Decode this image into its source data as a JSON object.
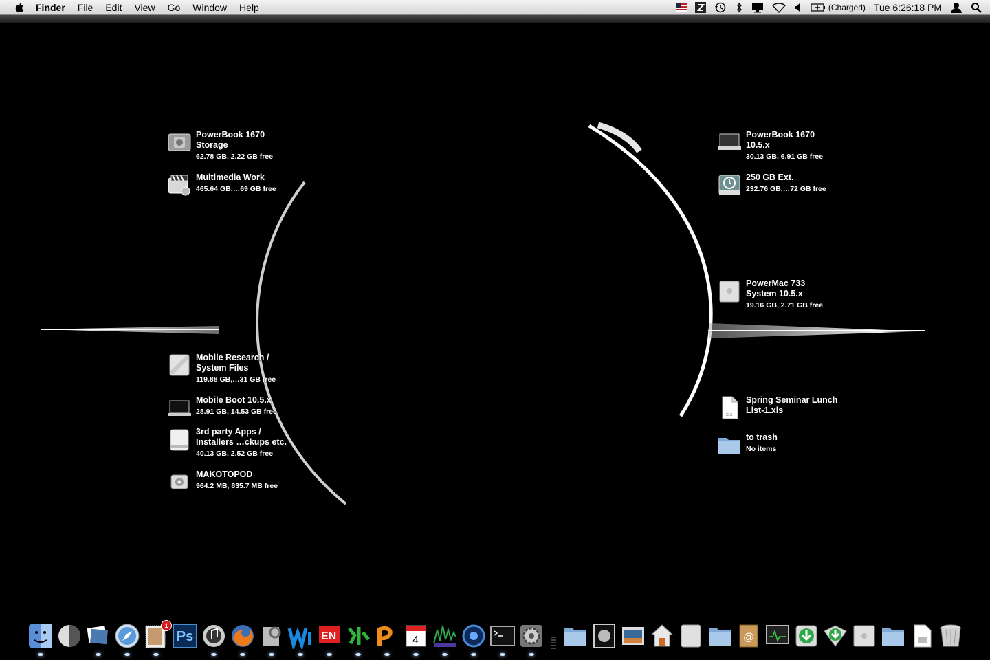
{
  "menubar": {
    "app_name": "Finder",
    "menus": [
      "File",
      "Edit",
      "View",
      "Go",
      "Window",
      "Help"
    ],
    "status": {
      "battery_text": "(Charged)",
      "clock": "Tue 6:26:18 PM"
    }
  },
  "desktop_left": [
    {
      "name": "PowerBook 1670\nStorage",
      "info": "62.78 GB, 2.22 GB free",
      "icon": "hard-disk-icon"
    },
    {
      "name": "Multimedia Work",
      "info": "465.64 GB,…69 GB free",
      "icon": "movie-disk-icon"
    },
    {
      "name": "Mobile Research /\nSystem Files",
      "info": "119.88 GB,…31 GB free",
      "icon": "external-disk-icon"
    },
    {
      "name": "Mobile Boot 10.5.x",
      "info": "28.91 GB, 14.53 GB free",
      "icon": "laptop-disk-icon"
    },
    {
      "name": "3rd party Apps /\nInstallers …ckups etc.",
      "info": "40.13 GB, 2.52 GB free",
      "icon": "drive-icon"
    },
    {
      "name": "MAKOTOPOD",
      "info": "964.2 MB, 835.7 MB free",
      "icon": "ipod-icon"
    }
  ],
  "desktop_right": [
    {
      "name": "PowerBook 1670\n10.5.x",
      "info": "30.13 GB, 6.91 GB free",
      "icon": "laptop-disk-icon"
    },
    {
      "name": "250 GB Ext.",
      "info": "232.76 GB,…72 GB free",
      "icon": "time-machine-disk-icon"
    },
    {
      "name": "PowerMac 733\nSystem 10.5.x",
      "info": "19.16 GB, 2.71 GB free",
      "icon": "powermac-disk-icon"
    },
    {
      "name": "Spring Seminar Lunch\nList-1.xls",
      "info": "",
      "icon": "xls-document-icon"
    },
    {
      "name": "to trash",
      "info": "No items",
      "icon": "folder-icon"
    }
  ],
  "dock": {
    "calendar_day": "4",
    "photoshop_label": "Ps",
    "badge_count": "1",
    "items": [
      "finder-icon",
      "dashboard-icon",
      "iphoto-icon",
      "safari-icon",
      "mail-stamp-icon",
      "photoshop-icon",
      "itunes-icon",
      "firefox-icon",
      "preview-icon",
      "wavelab-icon",
      "en-dictionary-icon",
      "green-app-icon",
      "orange-app-icon",
      "ical-icon",
      "waveform-icon",
      "network-icon",
      "terminal-icon",
      "system-preferences-icon",
      "folder-icon",
      "moon-icon",
      "pictures-icon",
      "home-icon",
      "documents-icon",
      "folder-icon",
      "address-icon",
      "activity-monitor-icon",
      "downloads-icon",
      "downloads-icon",
      "powermac-icon",
      "folder-icon",
      "document-icon",
      "trash-icon"
    ]
  }
}
